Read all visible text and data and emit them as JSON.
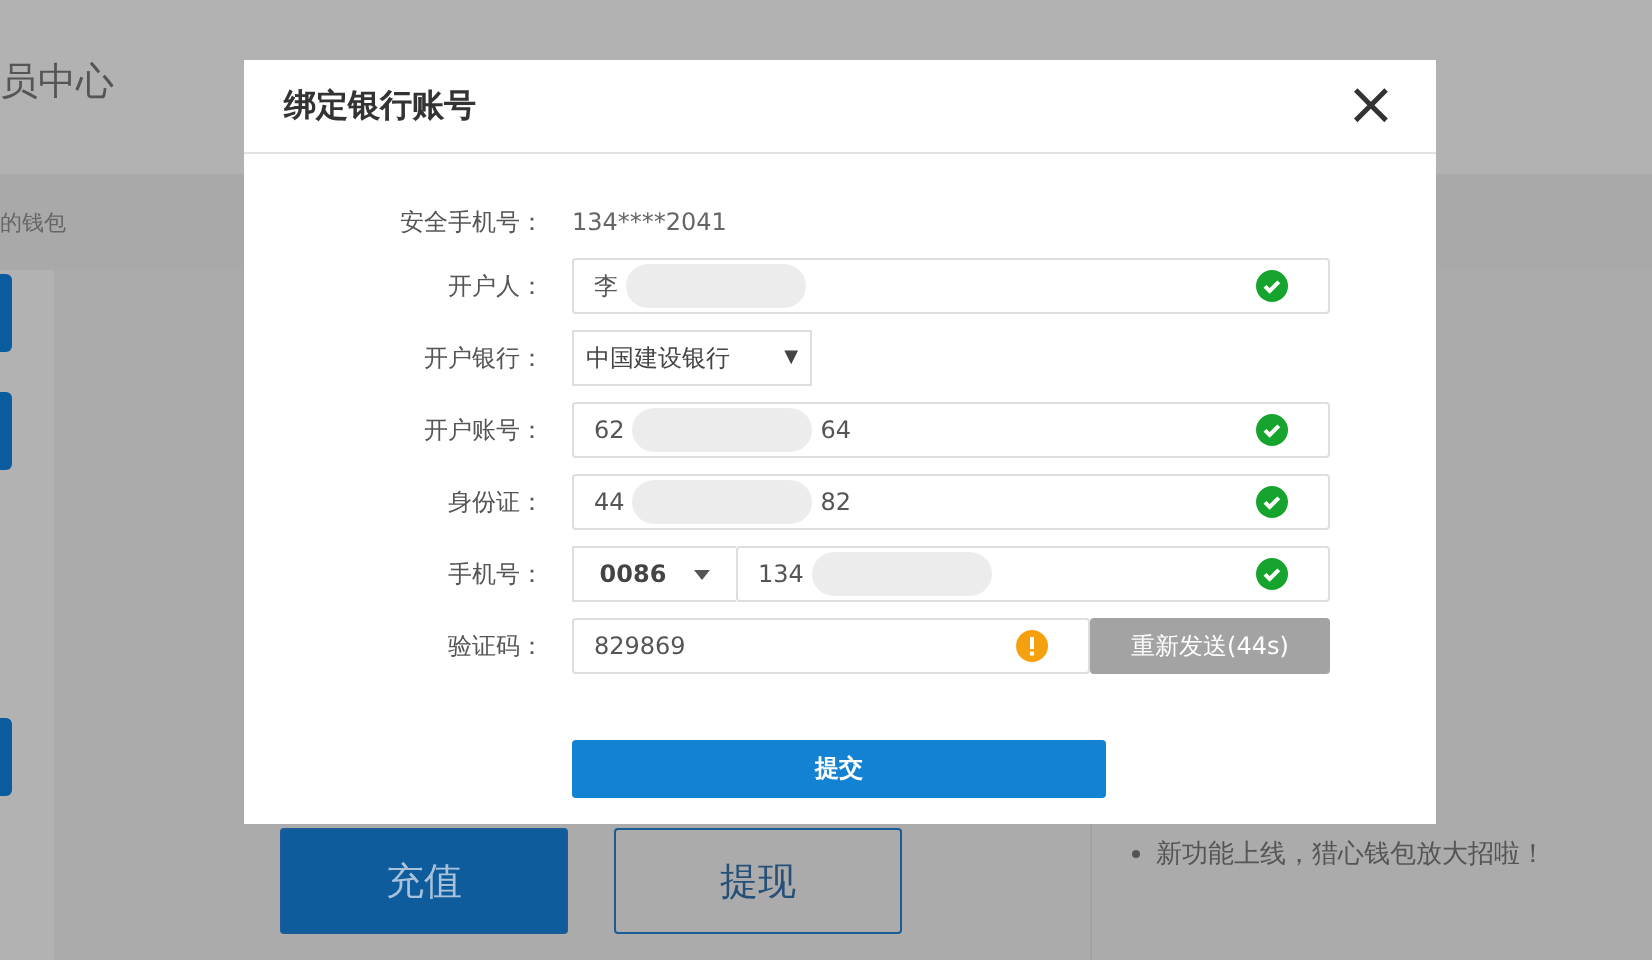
{
  "page": {
    "title": "员中心",
    "breadcrumb": "的钱包",
    "buttons": [
      {
        "label": "充值",
        "kind": "primary"
      },
      {
        "label": "提现",
        "kind": "outline"
      }
    ],
    "notices": [
      "新功能上线，猎心钱包放大招啦！"
    ]
  },
  "dialog": {
    "title": "绑定银行账号",
    "close": "×",
    "rows": [
      {
        "kind": "text",
        "label": "安全手机号：",
        "value": "134****2041"
      },
      {
        "kind": "input",
        "label": "开户人：",
        "parts": [
          "李"
        ],
        "valid": true
      },
      {
        "kind": "select",
        "label": "开户银行：",
        "value": "中国建设银行",
        "caret": "▼"
      },
      {
        "kind": "input",
        "label": "开户账号：",
        "parts": [
          "62",
          "64"
        ],
        "valid": true
      },
      {
        "kind": "input",
        "label": "身份证：",
        "parts": [
          "44",
          "82"
        ],
        "valid": true
      },
      {
        "kind": "phone",
        "label": "手机号：",
        "code": "0086",
        "parts": [
          "134"
        ],
        "valid": true
      },
      {
        "kind": "code",
        "label": "验证码：",
        "value": "829869",
        "valid": false,
        "resend": "重新发送(44s)",
        "disabled": true
      }
    ],
    "submit": "提交"
  }
}
